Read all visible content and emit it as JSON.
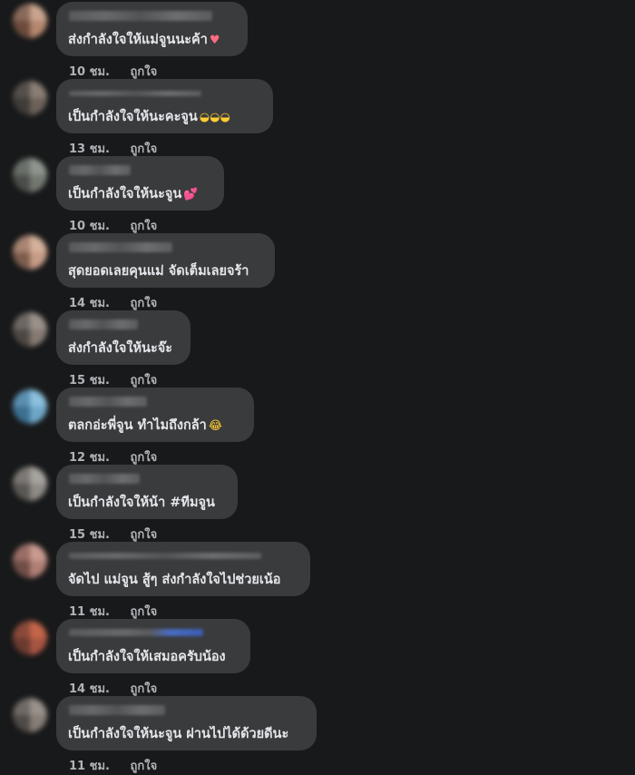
{
  "comments": [
    {
      "text": "ส่งกำลังใจให้แม่จูนนะค้า",
      "emoji": "♥",
      "emoji_kind": "heart",
      "time": "10 ชม.",
      "like": "ถูกใจ"
    },
    {
      "text": "เป็นกำลังใจให้นะคะจูน",
      "emoji": "◒◒◒",
      "emoji_kind": "face",
      "time": "13 ชม.",
      "like": "ถูกใจ"
    },
    {
      "text": "เป็นกำลังใจให้นะจูน",
      "emoji": "💕",
      "emoji_kind": "hearts",
      "time": "10 ชม.",
      "like": "ถูกใจ"
    },
    {
      "text": "สุดยอดเลยคุนแม่ จัดเต็มเลยจร้า",
      "emoji": "",
      "emoji_kind": "",
      "time": "14 ชม.",
      "like": "ถูกใจ"
    },
    {
      "text": "ส่งกำลังใจให้นะจ๊ะ",
      "emoji": "",
      "emoji_kind": "",
      "time": "15 ชม.",
      "like": "ถูกใจ"
    },
    {
      "text": "ตลกอ่ะพี่จูน ทำไมถึงกล้า",
      "emoji": "😂",
      "emoji_kind": "face",
      "time": "12 ชม.",
      "like": "ถูกใจ"
    },
    {
      "text": "เป็นกำลังใจให้น้า #ทีมจูน",
      "emoji": "",
      "emoji_kind": "",
      "time": "15 ชม.",
      "like": "ถูกใจ"
    },
    {
      "text": "จัดไป แม่จูน สู้ๆ ส่งกำลังใจไปช่วยเน้อ",
      "emoji": "",
      "emoji_kind": "",
      "time": "11 ชม.",
      "like": "ถูกใจ"
    },
    {
      "text": "เป็นกำลังใจให้เสมอครับน้อง",
      "emoji": "",
      "emoji_kind": "",
      "time": "14 ชม.",
      "like": "ถูกใจ"
    },
    {
      "text": "เป็นกำลังใจให้นะจูน ผ่านไปได้ด้วยดีนะ",
      "emoji": "",
      "emoji_kind": "",
      "time": "11 ชม.",
      "like": "ถูกใจ"
    }
  ],
  "colors": {
    "background": "#18191a",
    "bubble": "#3a3b3c",
    "text": "#e4e6eb",
    "meta": "#b0b3b8"
  }
}
